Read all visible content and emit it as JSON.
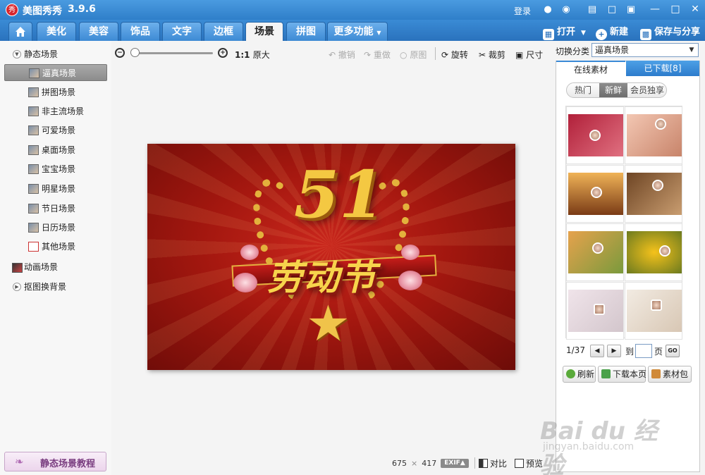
{
  "window": {
    "app_name": "美图秀秀",
    "version": "3.9.6",
    "logo_glyph": "秀",
    "login_label": "登录",
    "controls": [
      "qq-icon",
      "weibo-icon",
      "skin-icon",
      "message-icon",
      "feedback-icon",
      "minimize-icon",
      "maximize-icon",
      "close-icon"
    ]
  },
  "tabs": [
    {
      "label": "美化"
    },
    {
      "label": "美容"
    },
    {
      "label": "饰品"
    },
    {
      "label": "文字"
    },
    {
      "label": "边框"
    },
    {
      "label": "场景",
      "active": true
    },
    {
      "label": "拼图"
    }
  ],
  "more_label": "更多功能",
  "actions": {
    "open": "打开",
    "new": "新建",
    "save": "保存与分享"
  },
  "sidebar": {
    "static_group": "静态场景",
    "items": [
      {
        "label": "逼真场景",
        "selected": true
      },
      {
        "label": "拼图场景"
      },
      {
        "label": "非主流场景"
      },
      {
        "label": "可爱场景"
      },
      {
        "label": "桌面场景"
      },
      {
        "label": "宝宝场景"
      },
      {
        "label": "明星场景"
      },
      {
        "label": "节日场景"
      },
      {
        "label": "日历场景"
      },
      {
        "label": "其他场景"
      }
    ],
    "animated_group": "动画场景",
    "cutout_group": "抠图换背景",
    "tutorial_label": "静态场景教程"
  },
  "canvas_toolbar": {
    "ratio_label": "1:1",
    "original_label": "原大",
    "undo": "撤销",
    "redo": "重做",
    "original_image": "原图",
    "rotate": "旋转",
    "crop": "裁剪",
    "resize": "尺寸",
    "zoom_level": 0.03
  },
  "poster": {
    "number": "51",
    "title": "劳动节"
  },
  "status": {
    "width": "675",
    "separator": "×",
    "height": "417",
    "exif": "EXIF▲",
    "compare": "对比",
    "preview": "预览"
  },
  "right_panel": {
    "switch_label": "切换分类",
    "category_value": "逼真场景",
    "tab_online": "在线素材",
    "tab_downloaded": "已下载[8]",
    "filters": [
      "热门",
      "新鲜",
      "会员独享"
    ],
    "active_filter": "新鲜",
    "thumbnails": [
      {
        "name": "hearts-red"
      },
      {
        "name": "heart-hands"
      },
      {
        "name": "sunset-heart"
      },
      {
        "name": "coffee-cup"
      },
      {
        "name": "white-flower"
      },
      {
        "name": "sunflowers"
      },
      {
        "name": "white-daisies"
      },
      {
        "name": "paper-cup"
      }
    ],
    "page_info": "1/37",
    "goto_label": "到",
    "page_unit": "页",
    "go_label": "GO",
    "refresh": "刷新",
    "download_page": "下载本页",
    "material_pack": "素材包"
  },
  "watermark": {
    "text": "Bai du 经验",
    "url": "jingyan.baidu.com"
  },
  "colors": {
    "titlebar": "#3a8bd5",
    "selected": "#8c8c8c",
    "poster_bg": "#a3170f",
    "gold": "#f4c842"
  }
}
